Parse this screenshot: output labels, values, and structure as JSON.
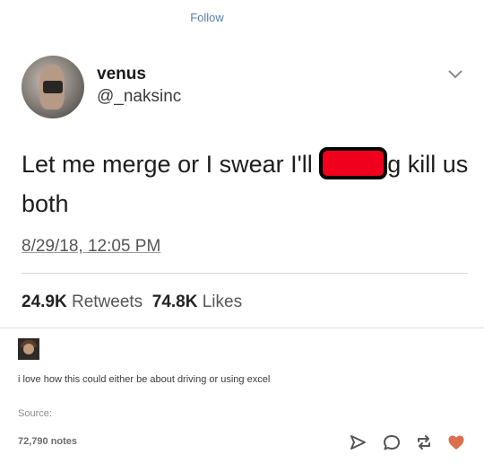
{
  "header": {
    "follow_label": "Follow"
  },
  "tweet": {
    "display_name": "venus",
    "handle": "@_naksinc",
    "text_before": "Let me merge or I swear I'll ",
    "text_after": "g kill us both",
    "timestamp": "8/29/18, 12:05 PM",
    "retweets_count": "24.9K",
    "retweets_label": "Retweets",
    "likes_count": "74.8K",
    "likes_label": "Likes"
  },
  "post": {
    "comment": "i love how this could either be about driving or using excel",
    "source_label": "Source:",
    "notes": "72,790 notes"
  },
  "icons": {
    "chevron": "chevron-down-icon",
    "send": "send-icon",
    "reply": "reply-icon",
    "reblog": "reblog-icon",
    "like": "heart-icon"
  },
  "colors": {
    "link": "#5a7db0",
    "redaction": "#f0001c",
    "heart": "#d96f4c"
  }
}
